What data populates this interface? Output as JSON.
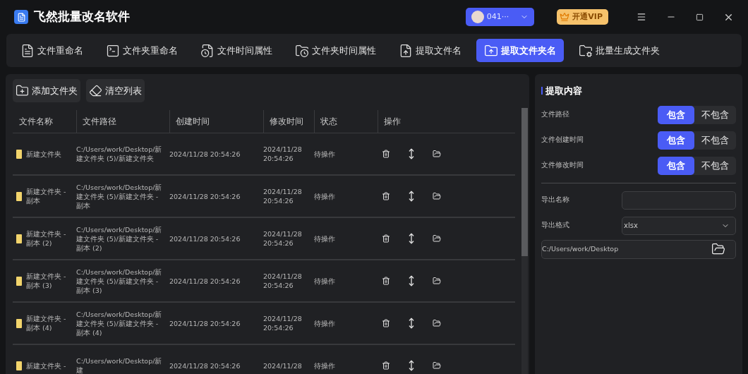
{
  "app": {
    "title": "飞然批量改名软件",
    "user": "041···",
    "vip_button": "开通VIP"
  },
  "tabs": [
    {
      "label": "文件重命名",
      "selected": false,
      "kind": "file"
    },
    {
      "label": "文件夹重命名",
      "selected": false,
      "kind": "terminal"
    },
    {
      "label": "文件时间属性",
      "selected": false,
      "kind": "filetime"
    },
    {
      "label": "文件夹时间属性",
      "selected": false,
      "kind": "foldertime"
    },
    {
      "label": "提取文件名",
      "selected": false,
      "kind": "extract"
    },
    {
      "label": "提取文件夹名",
      "selected": true,
      "kind": "upload"
    },
    {
      "label": "批量生成文件夹",
      "selected": false,
      "kind": "gear"
    }
  ],
  "toolbar": [
    {
      "label": "添加文件夹",
      "kind": "add"
    },
    {
      "label": "清空列表",
      "kind": "clear"
    }
  ],
  "table": {
    "columns": [
      "文件名称",
      "文件路径",
      "创建时间",
      "修改时间",
      "状态",
      "操作"
    ],
    "rows": [
      {
        "name": "新建文件夹",
        "path": "C:/Users/work/Desktop/新建文件夹 (5)/新建文件夹",
        "created": "2024/11/28 20:54:26",
        "modified": "2024/11/28 20:54:26",
        "status": "待操作"
      },
      {
        "name": "新建文件夹 - 副本",
        "path": "C:/Users/work/Desktop/新建文件夹 (5)/新建文件夹 - 副本",
        "created": "2024/11/28 20:54:26",
        "modified": "2024/11/28 20:54:26",
        "status": "待操作"
      },
      {
        "name": "新建文件夹 - 副本 (2)",
        "path": "C:/Users/work/Desktop/新建文件夹 (5)/新建文件夹 - 副本 (2)",
        "created": "2024/11/28 20:54:26",
        "modified": "2024/11/28 20:54:26",
        "status": "待操作"
      },
      {
        "name": "新建文件夹 - 副本 (3)",
        "path": "C:/Users/work/Desktop/新建文件夹 (5)/新建文件夹 - 副本 (3)",
        "created": "2024/11/28 20:54:26",
        "modified": "2024/11/28 20:54:26",
        "status": "待操作"
      },
      {
        "name": "新建文件夹 - 副本 (4)",
        "path": "C:/Users/work/Desktop/新建文件夹 (5)/新建文件夹 - 副本 (4)",
        "created": "2024/11/28 20:54:26",
        "modified": "2024/11/28 20:54:26",
        "status": "待操作"
      },
      {
        "name": "新建文件夹 -",
        "path": "C:/Users/work/Desktop/新建",
        "created": "2024/11/28 20:54:26",
        "modified": "2024/11/28",
        "status": "待操作"
      }
    ]
  },
  "panel": {
    "title": "提取内容",
    "options": [
      {
        "label": "文件路径",
        "choices": [
          {
            "label": "包含",
            "selected": true
          },
          {
            "label": "不包含",
            "selected": false
          }
        ]
      },
      {
        "label": "文件创建时间",
        "choices": [
          {
            "label": "包含",
            "selected": true
          },
          {
            "label": "不包含",
            "selected": false
          }
        ]
      },
      {
        "label": "文件修改时间",
        "choices": [
          {
            "label": "包含",
            "selected": true
          },
          {
            "label": "不包含",
            "selected": false
          }
        ]
      }
    ],
    "export_name_label": "导出名称",
    "export_format_label": "导出格式",
    "export_format": "xlsx",
    "export_path": "C:/Users/work/Desktop"
  }
}
